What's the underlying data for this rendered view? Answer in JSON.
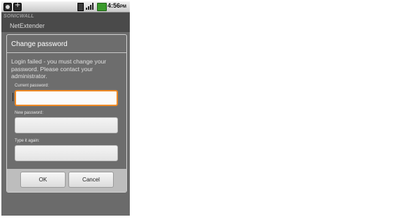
{
  "status_bar": {
    "time": "4:56",
    "ampm": "PM",
    "icons": [
      "gallery-icon",
      "usb-icon",
      "vibrate-icon",
      "signal-icon",
      "battery-icon"
    ]
  },
  "app": {
    "brand": "SONICWALL",
    "title": "NetExtender"
  },
  "dialog": {
    "title": "Change password",
    "message": "Login failed - you must change your password.  Please contact your administrator.",
    "fields": [
      {
        "label": "Current password:",
        "value": ""
      },
      {
        "label": "New password:",
        "value": ""
      },
      {
        "label": "Type it again:",
        "value": ""
      }
    ],
    "ok_label": "OK",
    "cancel_label": "Cancel"
  },
  "colors": {
    "focus_border": "#f08a24",
    "dialog_bg": "#6d6d6d",
    "button_bar_bg": "#bdbdbd"
  }
}
